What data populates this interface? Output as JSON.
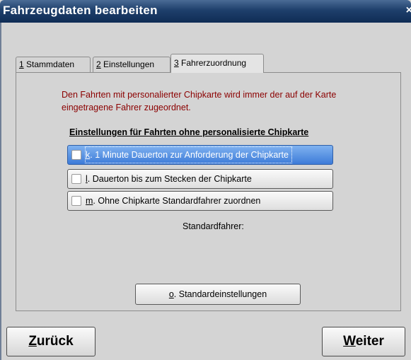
{
  "window": {
    "title": "Fahrzeugdaten bearbeiten",
    "close_glyph": "×"
  },
  "tabs": [
    {
      "mnemonic": "1",
      "label": " Stammdaten",
      "active": false
    },
    {
      "mnemonic": "2",
      "label": " Einstellungen",
      "active": false
    },
    {
      "mnemonic": "3",
      "label": " Fahrerzuordnung",
      "active": true
    }
  ],
  "info_text": "Den Fahrten mit personalierter Chipkarte wird immer der auf der Karte eingetragene Fahrer zugeordnet.",
  "section_heading": "Einstellungen für Fahrten ohne personalisierte Chipkarte",
  "options": [
    {
      "mnemonic": "k",
      "label": ". 1 Minute Dauerton zur Anforderung der Chipkarte",
      "checked": false,
      "focused": true
    },
    {
      "mnemonic": "l",
      "label": ". Dauerton bis zum Stecken der Chipkarte",
      "checked": false,
      "focused": false
    },
    {
      "mnemonic": "m",
      "label": ". Ohne Chipkarte Standardfahrer zuordnen",
      "checked": false,
      "focused": false
    }
  ],
  "standard_driver_label": "Standardfahrer:",
  "reset_button": {
    "mnemonic": "o",
    "label": ". Standardeinstellungen"
  },
  "nav": {
    "back": {
      "mnemonic": "Z",
      "label": "urück"
    },
    "next": {
      "mnemonic": "W",
      "label": "eiter"
    }
  },
  "colors": {
    "titlebar": "#1e3f6b",
    "info_text": "#8b0000",
    "focused_option": "#3d7bd8"
  }
}
